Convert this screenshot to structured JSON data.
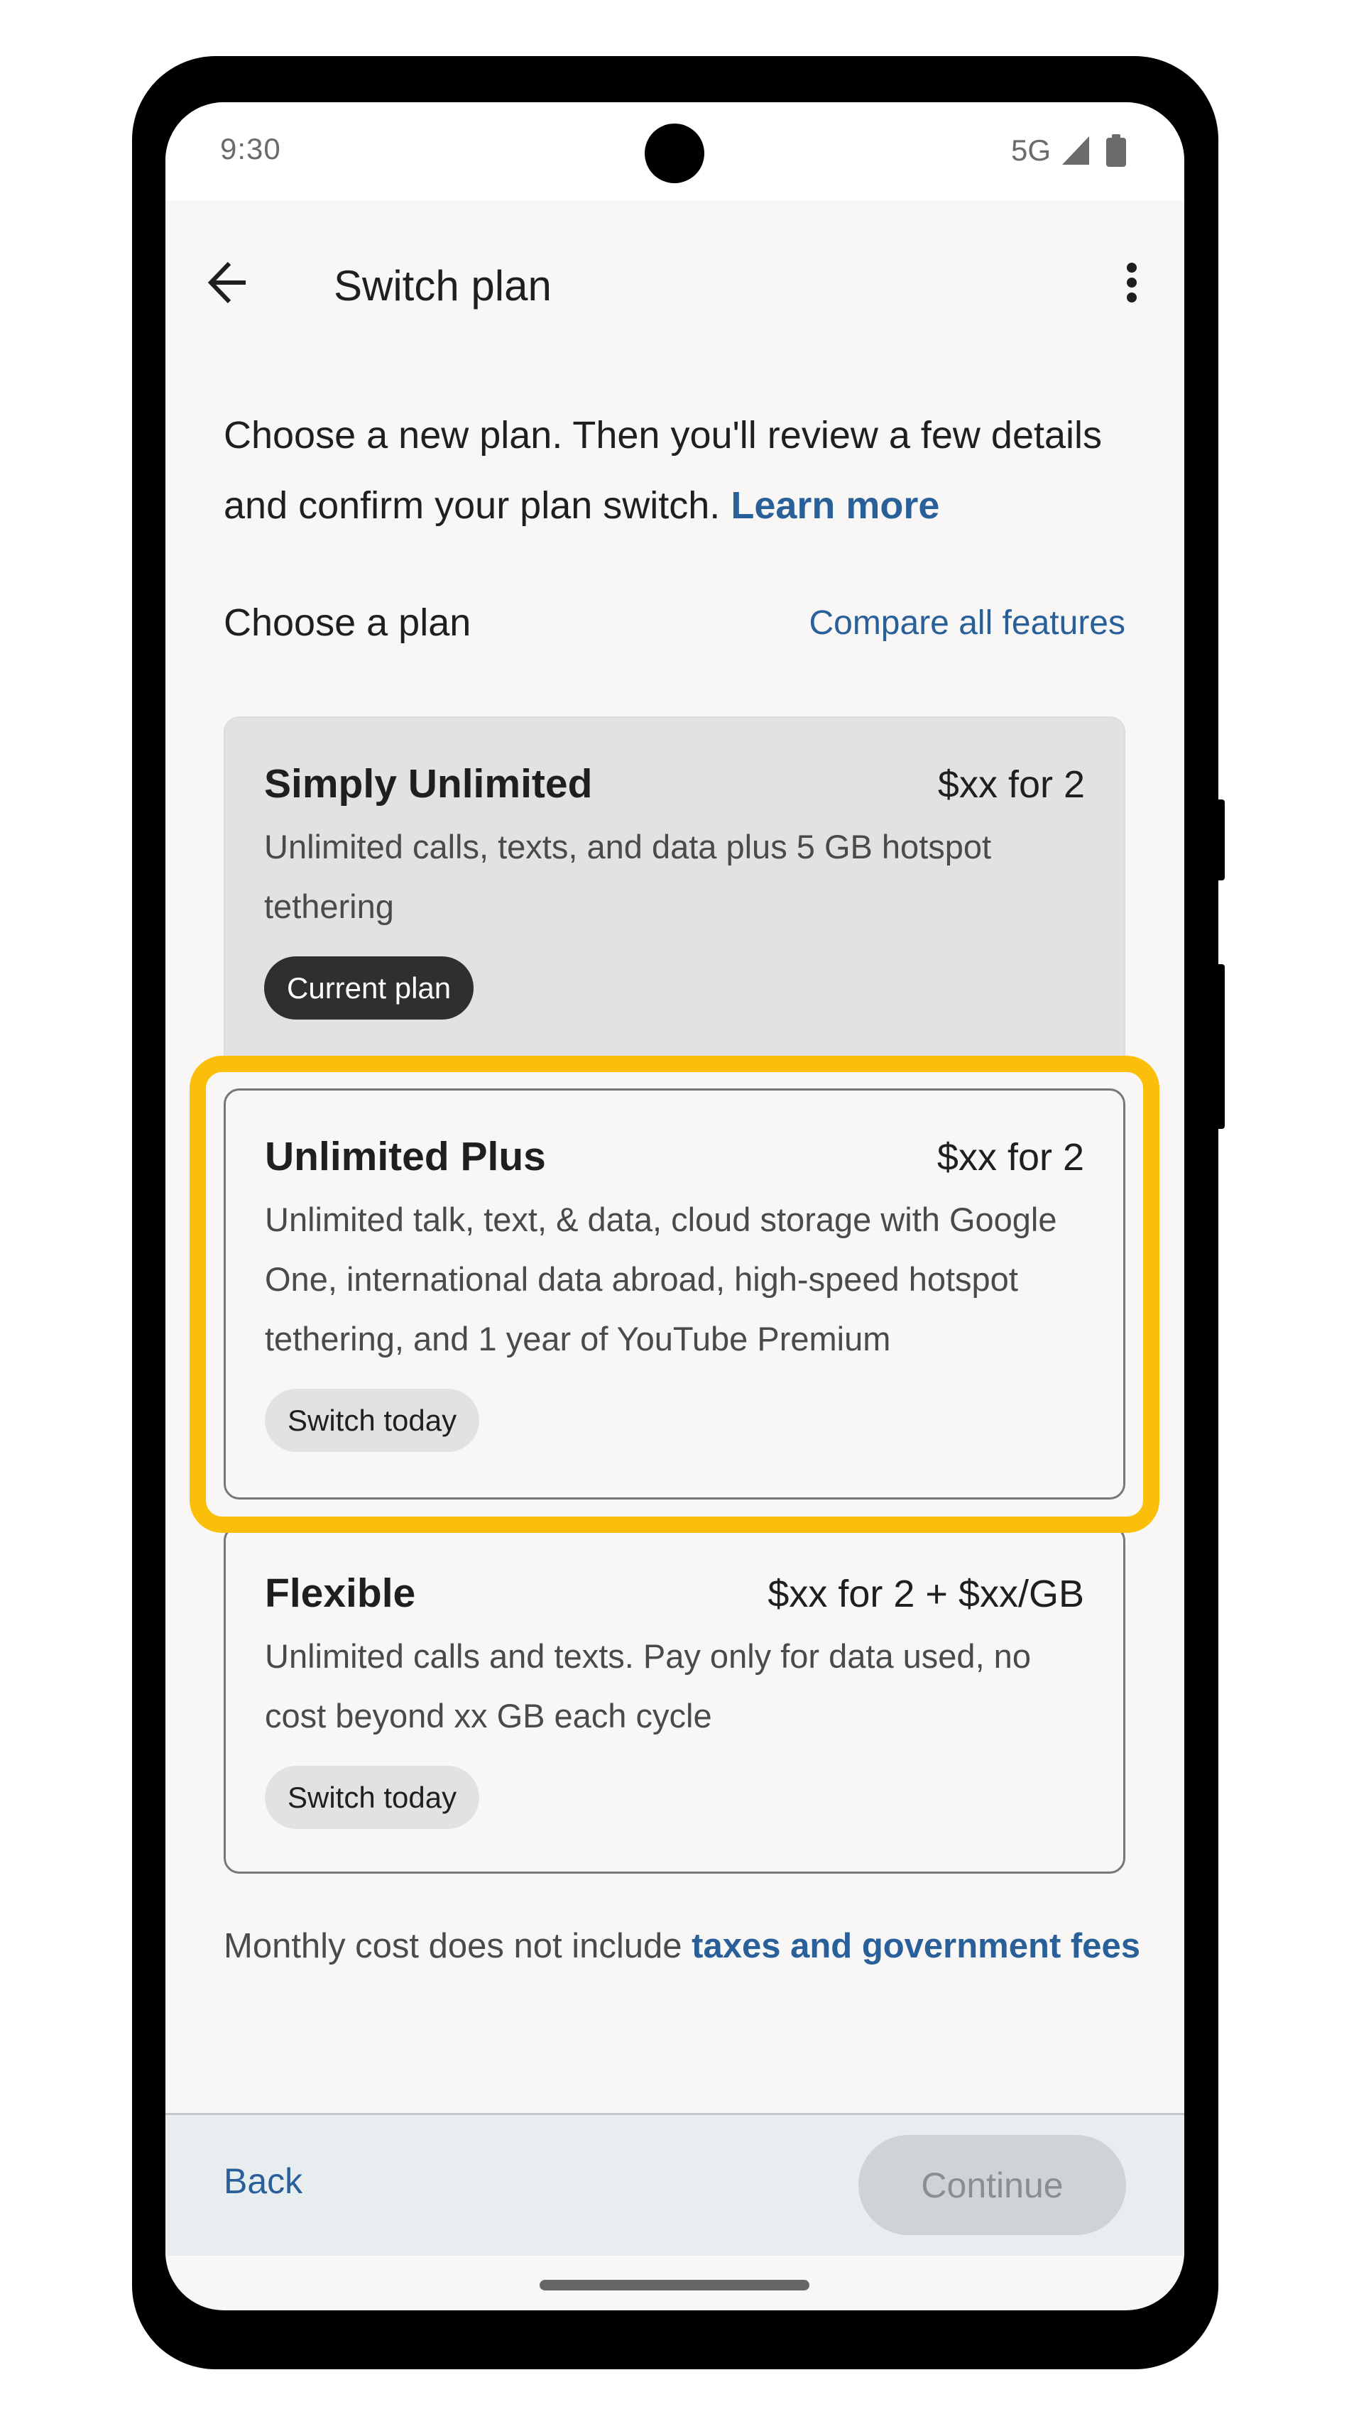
{
  "status_bar": {
    "time": "9:30",
    "network": "5G",
    "icons": [
      "signal-icon",
      "battery-icon"
    ]
  },
  "app_bar": {
    "back_icon": "arrow-left-icon",
    "title": "Switch plan",
    "menu_icon": "more-vert-icon"
  },
  "intro": {
    "text": "Choose a new plan. Then you'll review a few details and confirm your plan switch. ",
    "link": "Learn more"
  },
  "section": {
    "title": "Choose a plan",
    "compare_link": "Compare all features"
  },
  "plans": [
    {
      "name": "Simply Unlimited",
      "price": "$xx for 2",
      "description": "Unlimited calls, texts, and data plus 5 GB hotspot tethering",
      "chip": "Current plan",
      "state": "current"
    },
    {
      "name": "Unlimited Plus",
      "price": "$xx for 2",
      "description": "Unlimited talk, text, & data, cloud storage with Google One, international data abroad, high-speed hotspot tethering, and 1 year of YouTube Premium",
      "chip": "Switch today",
      "state": "highlighted"
    },
    {
      "name": "Flexible",
      "price": "$xx for 2 + $xx/GB",
      "description": "Unlimited calls and texts. Pay only for data used, no cost beyond xx GB each cycle",
      "chip": "Switch today",
      "state": "available"
    }
  ],
  "footnote": {
    "text": "Monthly cost does not include ",
    "link": "taxes and government fees"
  },
  "bottom_bar": {
    "back_label": "Back",
    "continue_label": "Continue",
    "continue_enabled": false
  },
  "colors": {
    "link": "#2a6099",
    "highlight": "#fbbf0a",
    "current_card": "#e2e2e2",
    "background": "#f8f7f5"
  }
}
